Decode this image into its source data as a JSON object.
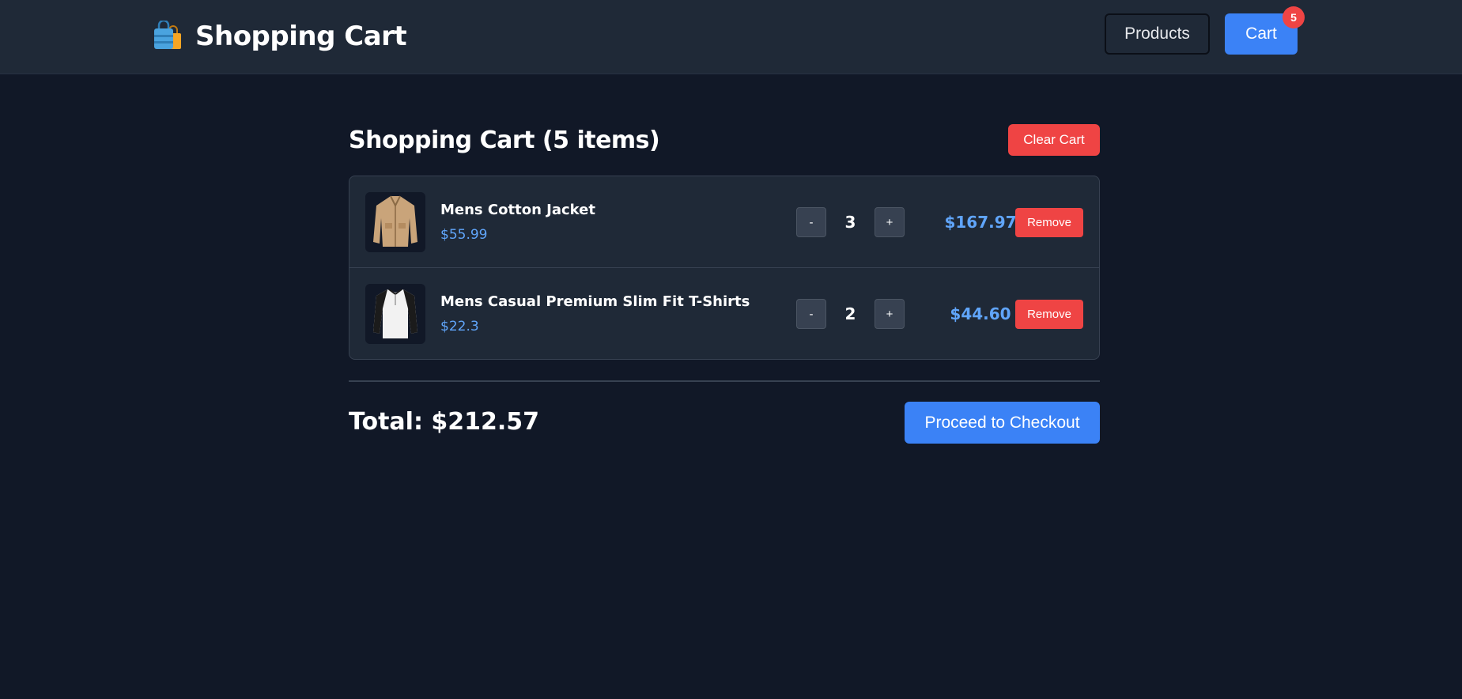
{
  "header": {
    "title": "Shopping Cart",
    "brand_icon": "shopping-bags-icon",
    "nav": {
      "products_label": "Products",
      "cart_label": "Cart",
      "cart_badge": "5"
    }
  },
  "cart": {
    "heading": "Shopping Cart (5 items)",
    "clear_label": "Clear Cart",
    "items": [
      {
        "name": "Mens Cotton Jacket",
        "price": "$55.99",
        "quantity": "3",
        "line_total": "$167.97",
        "minus_label": "-",
        "plus_label": "+",
        "remove_label": "Remove",
        "image_icon": "jacket-image"
      },
      {
        "name": "Mens Casual Premium Slim Fit T-Shirts",
        "price": "$22.3",
        "quantity": "2",
        "line_total": "$44.60",
        "minus_label": "-",
        "plus_label": "+",
        "remove_label": "Remove",
        "image_icon": "tshirt-image"
      }
    ],
    "total": "Total: $212.57",
    "checkout_label": "Proceed to Checkout"
  },
  "colors": {
    "background": "#111827",
    "surface": "#1f2937",
    "accent": "#3b82f6",
    "danger": "#ef4444",
    "price": "#60a5fa"
  }
}
